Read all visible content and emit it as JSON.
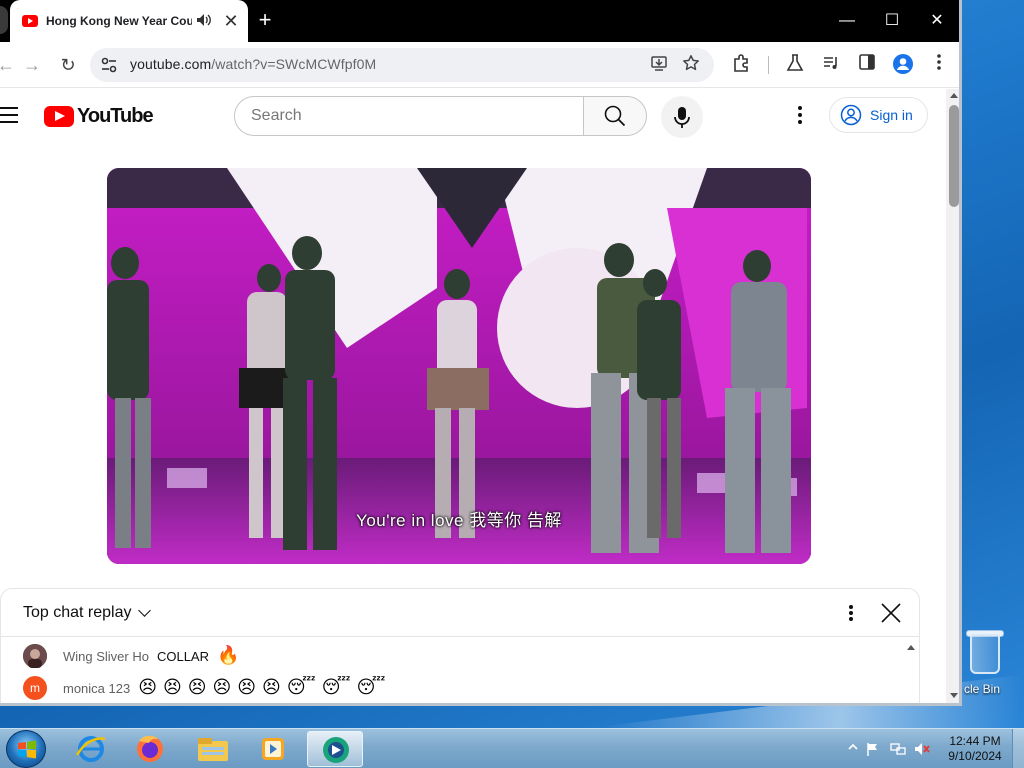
{
  "desktop": {
    "recycle_bin_label": "cle Bin"
  },
  "browser": {
    "tab": {
      "title": "Hong Kong New Year Coun",
      "audio_icon": "speaker-icon",
      "close_label": "✕"
    },
    "new_tab_label": "+",
    "window_controls": {
      "minimize": "—",
      "maximize": "☐",
      "close": "✕"
    },
    "toolbar": {
      "back": "←",
      "forward": "→",
      "reload": "↻",
      "url_host": "youtube.com",
      "url_path": "/watch?v=SWcMCWfpf0M",
      "icons": [
        "install-app-icon",
        "bookmark-star-icon",
        "extensions-icon",
        "labs-icon",
        "media-controls-icon",
        "side-panel-icon",
        "profile-icon",
        "menu-icon"
      ]
    }
  },
  "youtube": {
    "logo_text": "YouTube",
    "search": {
      "placeholder": "Search",
      "value": ""
    },
    "signin_label": "Sign in",
    "video": {
      "subtitle": "You're in love 我等你 告解"
    },
    "chat": {
      "title": "Top chat replay",
      "messages": [
        {
          "author": "Wing Sliver Ho",
          "text": "COLLAR",
          "emojis": [
            "🔥"
          ],
          "avatar_color": "#5a3a3a",
          "avatar_letter": ""
        },
        {
          "author": "monica 123",
          "text": "",
          "emojis": [
            "😣",
            "😣",
            "😣",
            "😣",
            "😣",
            "😣",
            "😴",
            "😴",
            "😴"
          ],
          "avatar_color": "#f4511e",
          "avatar_letter": "m"
        }
      ]
    }
  },
  "taskbar": {
    "apps": [
      "internet-explorer-icon",
      "firefox-icon",
      "file-explorer-icon",
      "media-player-icon",
      "chrome-like-app-icon"
    ],
    "clock_time": "12:44 PM",
    "clock_date": "9/10/2024"
  },
  "colors": {
    "youtube_red": "#ff0000",
    "signin_blue": "#065fd4",
    "desktop_blue": "#1f79cc"
  }
}
